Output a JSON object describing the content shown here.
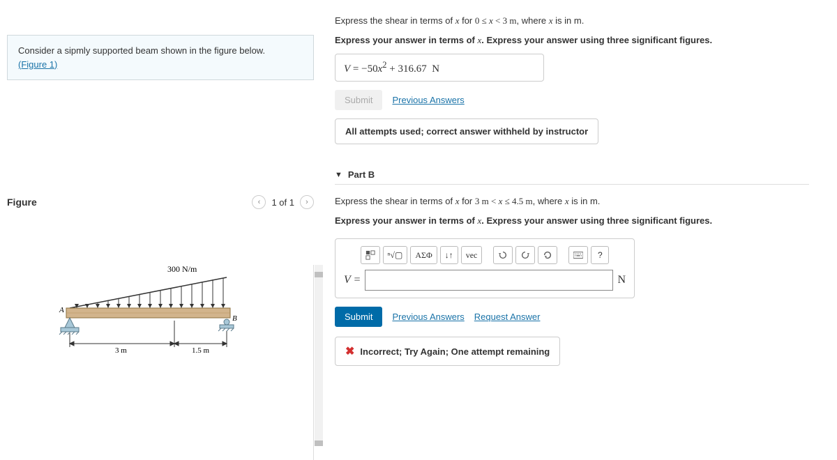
{
  "intro": {
    "text": "Consider a sipmly supported beam shown in the figure below.",
    "figure_link": "(Figure 1)"
  },
  "figure": {
    "heading": "Figure",
    "nav": "1 of 1",
    "load_label": "300 N/m",
    "point_A": "A",
    "point_B": "B",
    "dim1": "3 m",
    "dim2": "1.5 m"
  },
  "partA": {
    "prompt1_pre": "Express the shear in terms of ",
    "prompt1_mid": " for ",
    "prompt1_range": "0 ≤ x < 3 m",
    "prompt1_post": ", where ",
    "prompt1_end": " is in m.",
    "prompt2_pre": "Express your answer in terms of ",
    "prompt2_post": ". Express your answer using three significant figures.",
    "answer": "V = −50x² + 316.67  N",
    "submit": "Submit",
    "prev": "Previous Answers",
    "status": "All attempts used; correct answer withheld by instructor"
  },
  "partB": {
    "title": "Part B",
    "prompt1_pre": "Express the shear in terms of ",
    "prompt1_mid": " for ",
    "prompt1_range": "3 m < x ≤ 4.5 m",
    "prompt1_post": ", where ",
    "prompt1_end": " is in m.",
    "prompt2_pre": "Express your answer in terms of ",
    "prompt2_post": ". Express your answer using three significant figures.",
    "prefix": "V =",
    "unit": "N",
    "submit": "Submit",
    "prev": "Previous Answers",
    "req": "Request Answer",
    "incorrect": "Incorrect; Try Again; One attempt remaining",
    "toolbar": {
      "templates": "templates",
      "sqrt": "sqrt",
      "greek": "ΑΣΦ",
      "updown": "↓↑",
      "vec": "vec",
      "undo": "undo",
      "redo": "redo",
      "reset": "reset",
      "keyboard": "keyboard",
      "help": "?"
    }
  }
}
